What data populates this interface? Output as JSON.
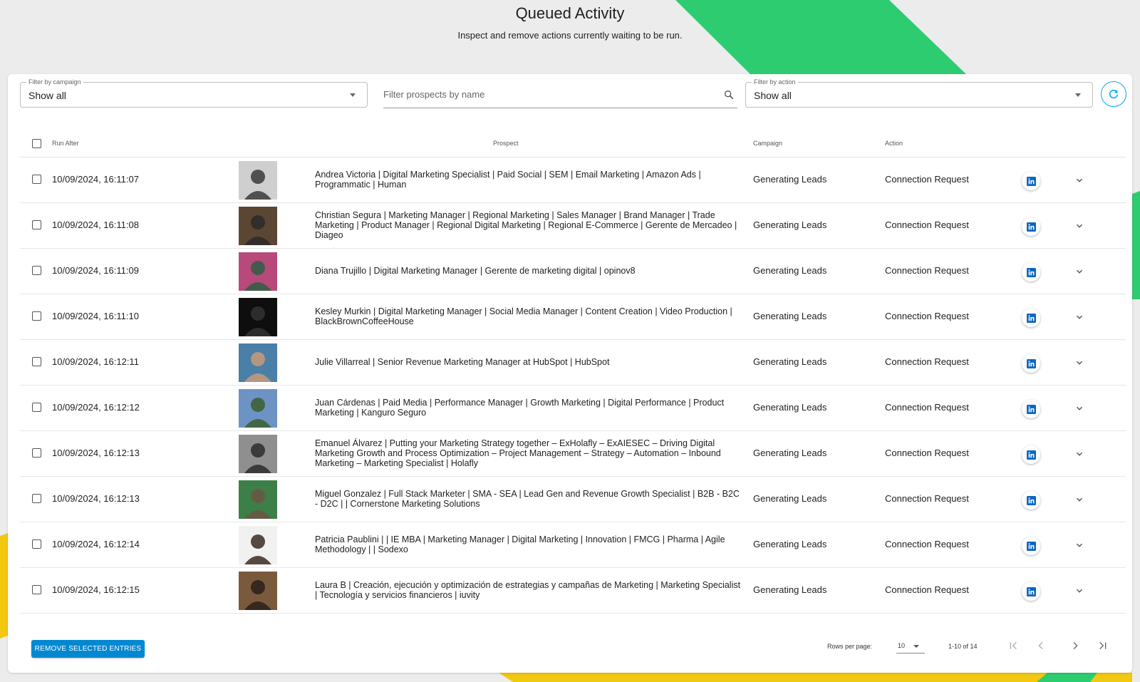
{
  "header": {
    "title": "Queued Activity",
    "subtitle": "Inspect and remove actions currently waiting to be run."
  },
  "filters": {
    "campaign_label": "Filter by campaign",
    "campaign_value": "Show all",
    "search_placeholder": "Filter prospects by name",
    "action_label": "Filter by action",
    "action_value": "Show all"
  },
  "table": {
    "columns": {
      "run_after": "Run After",
      "prospect": "Prospect",
      "campaign": "Campaign",
      "action": "Action"
    },
    "rows": [
      {
        "run_after": "10/09/2024, 16:11:07",
        "prospect": "Andrea Victoria | Digital Marketing Specialist | Paid Social | SEM | Email Marketing | Amazon Ads | Programmatic  | Human",
        "campaign": "Generating Leads",
        "action": "Connection Request"
      },
      {
        "run_after": "10/09/2024, 16:11:08",
        "prospect": "Christian Segura | Marketing Manager | Regional Marketing | Sales Manager | Brand Manager | Trade Marketing | Product Manager | Regional Digital Marketing | Regional E-Commerce | Gerente de Mercadeo  | Diageo",
        "campaign": "Generating Leads",
        "action": "Connection Request"
      },
      {
        "run_after": "10/09/2024, 16:11:09",
        "prospect": "Diana Trujillo | Digital Marketing Manager | Gerente de marketing digital  | opinov8",
        "campaign": "Generating Leads",
        "action": "Connection Request"
      },
      {
        "run_after": "10/09/2024, 16:11:10",
        "prospect": "Kesley Murkin | Digital Marketing Manager | Social Media Manager | Content Creation | Video Production  | BlackBrownCoffeeHouse",
        "campaign": "Generating Leads",
        "action": "Connection Request"
      },
      {
        "run_after": "10/09/2024, 16:12:11",
        "prospect": "Julie Villarreal | Senior Revenue Marketing Manager at HubSpot  | HubSpot",
        "campaign": "Generating Leads",
        "action": "Connection Request"
      },
      {
        "run_after": "10/09/2024, 16:12:12",
        "prospect": "Juan Cárdenas | Paid Media | Performance Manager | Growth Marketing | Digital Performance | Product Marketing  | Kanguro Seguro",
        "campaign": "Generating Leads",
        "action": "Connection Request"
      },
      {
        "run_after": "10/09/2024, 16:12:13",
        "prospect": "Emanuel Álvarez | Putting your Marketing Strategy together – ExHolafly – ExAIESEC – Driving Digital Marketing Growth and Process Optimization – Project Management – Strategy – Automation – Inbound Marketing – Marketing Specialist  | Holafly",
        "campaign": "Generating Leads",
        "action": "Connection Request"
      },
      {
        "run_after": "10/09/2024, 16:12:13",
        "prospect": "Miguel Gonzalez | Full Stack Marketer | SMA - SEA | Lead Gen and Revenue Growth Specialist | B2B - B2C - D2C |  | Cornerstone Marketing Solutions",
        "campaign": "Generating Leads",
        "action": "Connection Request"
      },
      {
        "run_after": "10/09/2024, 16:12:14",
        "prospect": "Patricia Paublini | | IE MBA | Marketing Manager | Digital Marketing | Innovation | FMCG | Pharma | Agile Methodology |  | Sodexo",
        "campaign": "Generating Leads",
        "action": "Connection Request"
      },
      {
        "run_after": "10/09/2024, 16:12:15",
        "prospect": "Laura B | Creación, ejecución y optimización de estrategias y campañas de Marketing | Marketing Specialist | Tecnología y servicios financieros  | iuvity",
        "campaign": "Generating Leads",
        "action": "Connection Request"
      }
    ]
  },
  "footer": {
    "remove_button": "REMOVE SELECTED ENTRIES",
    "rows_per_page_label": "Rows per page:",
    "rows_per_page_value": "10",
    "range": "1-10 of 14"
  },
  "colors": {
    "accent_blue": "#0288d1",
    "refresh_blue": "#03a9f4",
    "linkedin_blue": "#0a66c2",
    "bg_green": "#2ecc71",
    "bg_yellow": "#f2c811"
  },
  "icons": {
    "search": "search-icon",
    "refresh": "refresh-icon",
    "linkedin": "linkedin-icon",
    "expand": "chevron-down-icon",
    "first_page": "first-page-icon",
    "prev_page": "chevron-left-icon",
    "next_page": "chevron-right-icon",
    "last_page": "last-page-icon"
  }
}
